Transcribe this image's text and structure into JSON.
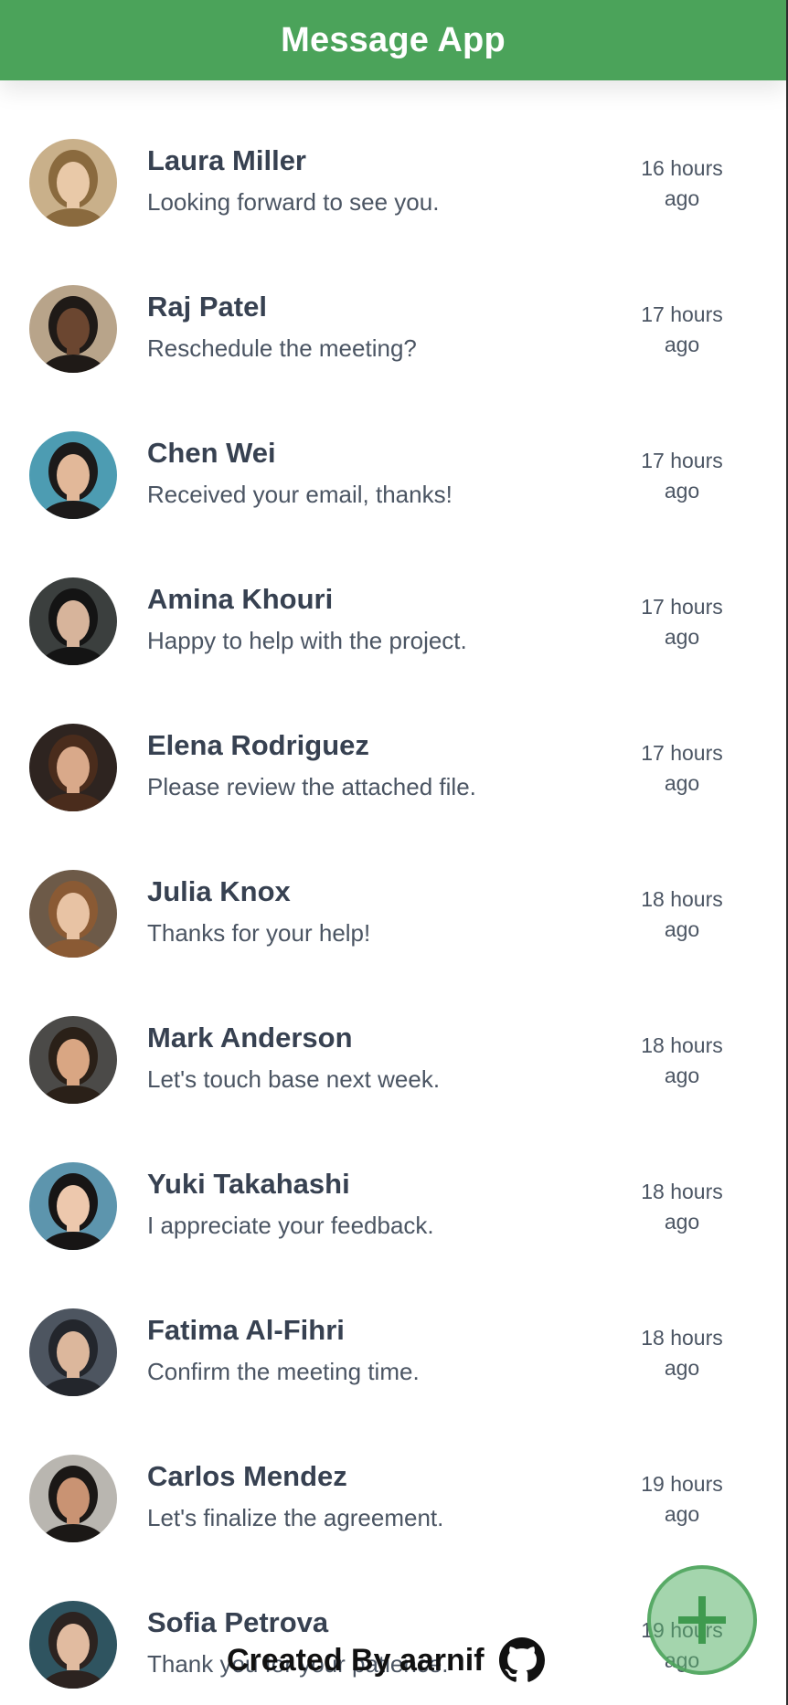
{
  "header": {
    "title": "Message App"
  },
  "conversations": [
    {
      "name": "Laura Miller",
      "preview": "Looking forward to see you.",
      "time_line1": "16 hours",
      "time_line2": "ago",
      "avatar_bg": "#c9b08a",
      "avatar_hair": "#8a6a3e",
      "avatar_skin": "#e9c9a8"
    },
    {
      "name": "Raj Patel",
      "preview": "Reschedule the meeting?",
      "time_line1": "17 hours",
      "time_line2": "ago",
      "avatar_bg": "#b8a48a",
      "avatar_hair": "#1f1a17",
      "avatar_skin": "#6b4630"
    },
    {
      "name": "Chen Wei",
      "preview": "Received your email, thanks!",
      "time_line1": "17 hours",
      "time_line2": "ago",
      "avatar_bg": "#4d9cb2",
      "avatar_hair": "#1c1a1a",
      "avatar_skin": "#e2b899"
    },
    {
      "name": "Amina Khouri",
      "preview": "Happy to help with the project.",
      "time_line1": "17 hours",
      "time_line2": "ago",
      "avatar_bg": "#3b3f3e",
      "avatar_hair": "#141414",
      "avatar_skin": "#d7b49b"
    },
    {
      "name": "Elena Rodriguez",
      "preview": "Please review the attached file.",
      "time_line1": "17 hours",
      "time_line2": "ago",
      "avatar_bg": "#2e2420",
      "avatar_hair": "#4a2c1c",
      "avatar_skin": "#d9a98a"
    },
    {
      "name": "Julia Knox",
      "preview": "Thanks for your help!",
      "time_line1": "18 hours",
      "time_line2": "ago",
      "avatar_bg": "#6d5a48",
      "avatar_hair": "#8a5a34",
      "avatar_skin": "#e8c3a4"
    },
    {
      "name": "Mark Anderson",
      "preview": "Let's touch base next week.",
      "time_line1": "18 hours",
      "time_line2": "ago",
      "avatar_bg": "#4b4a48",
      "avatar_hair": "#2a2018",
      "avatar_skin": "#d9a683"
    },
    {
      "name": "Yuki Takahashi",
      "preview": "I appreciate your feedback.",
      "time_line1": "18 hours",
      "time_line2": "ago",
      "avatar_bg": "#5d95ad",
      "avatar_hair": "#171515",
      "avatar_skin": "#edc8ad"
    },
    {
      "name": "Fatima Al-Fihri",
      "preview": "Confirm the meeting time.",
      "time_line1": "18 hours",
      "time_line2": "ago",
      "avatar_bg": "#4d5560",
      "avatar_hair": "#23262c",
      "avatar_skin": "#dcb79c"
    },
    {
      "name": "Carlos Mendez",
      "preview": "Let's finalize the agreement.",
      "time_line1": "19 hours",
      "time_line2": "ago",
      "avatar_bg": "#b9b6b0",
      "avatar_hair": "#1b1816",
      "avatar_skin": "#c99373"
    },
    {
      "name": "Sofia Petrova",
      "preview": "Thank you for your patience.",
      "time_line1": "19 hours",
      "time_line2": "ago",
      "avatar_bg": "#2f5460",
      "avatar_hair": "#2c2320",
      "avatar_skin": "#e1bba0"
    }
  ],
  "fab": {
    "icon": "plus-icon",
    "color": "#4ba35a"
  },
  "footer": {
    "credit_text": "Created By aarnif",
    "icon": "github-icon"
  },
  "theme": {
    "accent": "#4ba35a",
    "name_color": "#374151",
    "text_color": "#4b5563"
  }
}
